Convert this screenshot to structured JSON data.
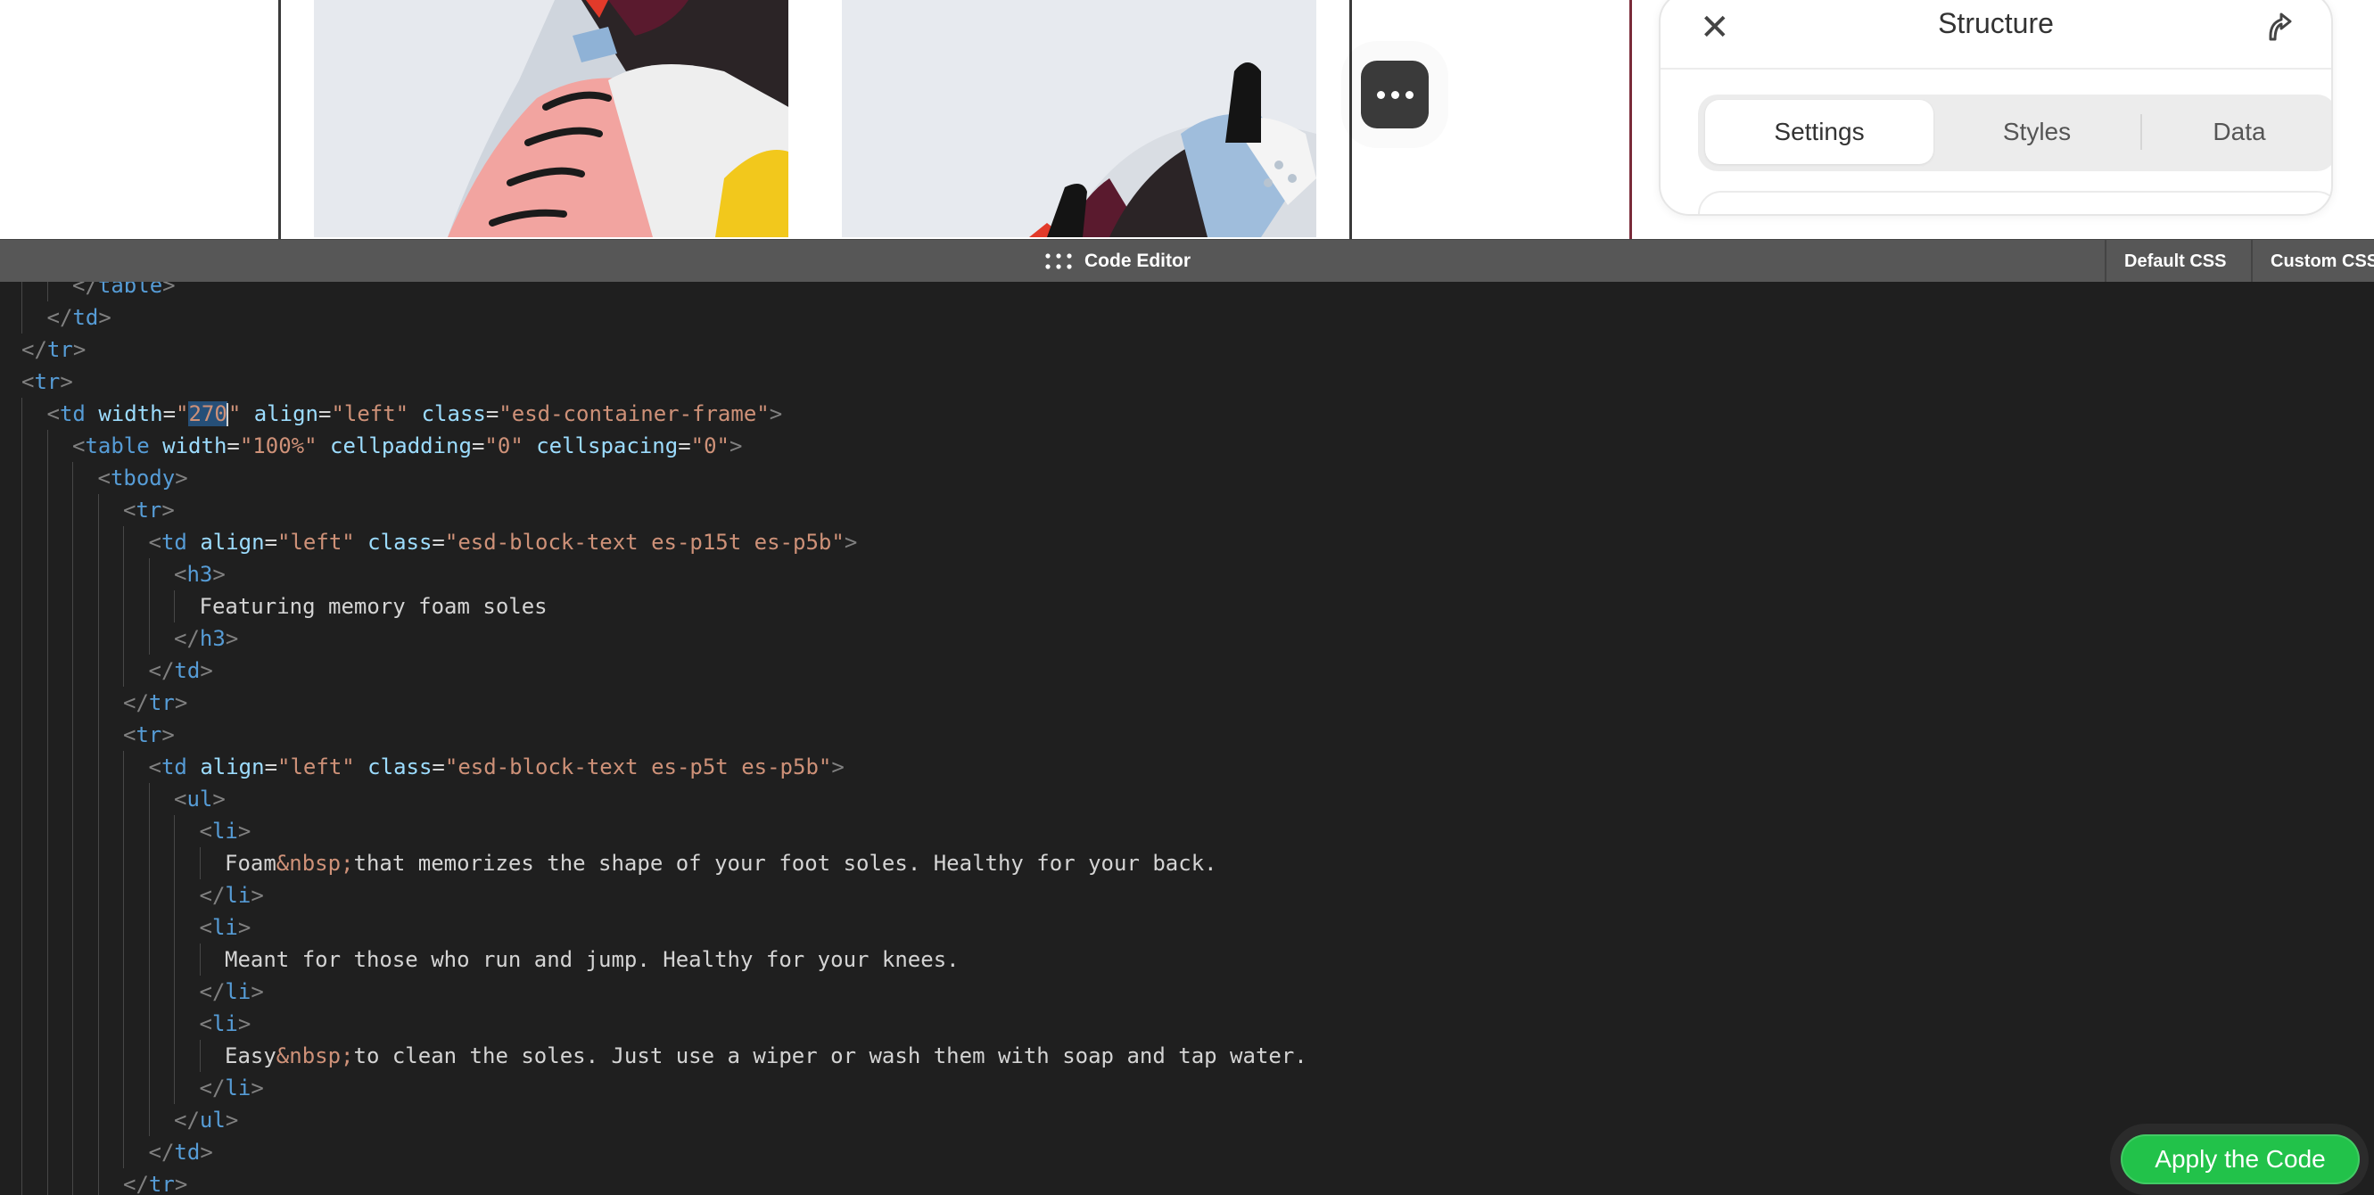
{
  "structure_panel": {
    "title": "Structure",
    "tabs": [
      {
        "label": "Settings",
        "active": true
      },
      {
        "label": "Styles",
        "active": false
      },
      {
        "label": "Data",
        "active": false
      }
    ]
  },
  "editor": {
    "title": "Code Editor",
    "default_css_label": "Default CSS",
    "custom_css_label": "Custom CSS",
    "apply_label": "Apply the Code",
    "selected_text": "270",
    "code_lines": [
      {
        "indent": 2,
        "tokens": [
          [
            "p",
            "</"
          ],
          [
            "t",
            "table"
          ],
          [
            "p",
            ">"
          ]
        ]
      },
      {
        "indent": 1,
        "tokens": [
          [
            "p",
            "</"
          ],
          [
            "t",
            "td"
          ],
          [
            "p",
            ">"
          ]
        ]
      },
      {
        "indent": 0,
        "tokens": [
          [
            "p",
            "</"
          ],
          [
            "t",
            "tr"
          ],
          [
            "p",
            ">"
          ]
        ]
      },
      {
        "indent": 0,
        "tokens": [
          [
            "p",
            "<"
          ],
          [
            "t",
            "tr"
          ],
          [
            "p",
            ">"
          ]
        ]
      },
      {
        "indent": 1,
        "tokens": [
          [
            "p",
            "<"
          ],
          [
            "t",
            "td"
          ],
          [
            "x",
            " "
          ],
          [
            "a",
            "width"
          ],
          [
            "x",
            "="
          ],
          [
            "v",
            "\""
          ],
          [
            "sel",
            "270"
          ],
          [
            "cursor",
            ""
          ],
          [
            "v",
            "\""
          ],
          [
            "x",
            " "
          ],
          [
            "a",
            "align"
          ],
          [
            "x",
            "="
          ],
          [
            "v",
            "\"left\""
          ],
          [
            "x",
            " "
          ],
          [
            "a",
            "class"
          ],
          [
            "x",
            "="
          ],
          [
            "v",
            "\"esd-container-frame\""
          ],
          [
            "p",
            ">"
          ]
        ]
      },
      {
        "indent": 2,
        "tokens": [
          [
            "p",
            "<"
          ],
          [
            "t",
            "table"
          ],
          [
            "x",
            " "
          ],
          [
            "a",
            "width"
          ],
          [
            "x",
            "="
          ],
          [
            "v",
            "\"100%\""
          ],
          [
            "x",
            " "
          ],
          [
            "a",
            "cellpadding"
          ],
          [
            "x",
            "="
          ],
          [
            "v",
            "\"0\""
          ],
          [
            "x",
            " "
          ],
          [
            "a",
            "cellspacing"
          ],
          [
            "x",
            "="
          ],
          [
            "v",
            "\"0\""
          ],
          [
            "p",
            ">"
          ]
        ]
      },
      {
        "indent": 3,
        "tokens": [
          [
            "p",
            "<"
          ],
          [
            "t",
            "tbody"
          ],
          [
            "p",
            ">"
          ]
        ]
      },
      {
        "indent": 4,
        "tokens": [
          [
            "p",
            "<"
          ],
          [
            "t",
            "tr"
          ],
          [
            "p",
            ">"
          ]
        ]
      },
      {
        "indent": 5,
        "tokens": [
          [
            "p",
            "<"
          ],
          [
            "t",
            "td"
          ],
          [
            "x",
            " "
          ],
          [
            "a",
            "align"
          ],
          [
            "x",
            "="
          ],
          [
            "v",
            "\"left\""
          ],
          [
            "x",
            " "
          ],
          [
            "a",
            "class"
          ],
          [
            "x",
            "="
          ],
          [
            "v",
            "\"esd-block-text es-p15t es-p5b\""
          ],
          [
            "p",
            ">"
          ]
        ]
      },
      {
        "indent": 6,
        "tokens": [
          [
            "p",
            "<"
          ],
          [
            "t",
            "h3"
          ],
          [
            "p",
            ">"
          ]
        ]
      },
      {
        "indent": 7,
        "tokens": [
          [
            "x",
            "Featuring memory foam soles"
          ]
        ]
      },
      {
        "indent": 6,
        "tokens": [
          [
            "p",
            "</"
          ],
          [
            "t",
            "h3"
          ],
          [
            "p",
            ">"
          ]
        ]
      },
      {
        "indent": 5,
        "tokens": [
          [
            "p",
            "</"
          ],
          [
            "t",
            "td"
          ],
          [
            "p",
            ">"
          ]
        ]
      },
      {
        "indent": 4,
        "tokens": [
          [
            "p",
            "</"
          ],
          [
            "t",
            "tr"
          ],
          [
            "p",
            ">"
          ]
        ]
      },
      {
        "indent": 4,
        "tokens": [
          [
            "p",
            "<"
          ],
          [
            "t",
            "tr"
          ],
          [
            "p",
            ">"
          ]
        ]
      },
      {
        "indent": 5,
        "tokens": [
          [
            "p",
            "<"
          ],
          [
            "t",
            "td"
          ],
          [
            "x",
            " "
          ],
          [
            "a",
            "align"
          ],
          [
            "x",
            "="
          ],
          [
            "v",
            "\"left\""
          ],
          [
            "x",
            " "
          ],
          [
            "a",
            "class"
          ],
          [
            "x",
            "="
          ],
          [
            "v",
            "\"esd-block-text es-p5t es-p5b\""
          ],
          [
            "p",
            ">"
          ]
        ]
      },
      {
        "indent": 6,
        "tokens": [
          [
            "p",
            "<"
          ],
          [
            "t",
            "ul"
          ],
          [
            "p",
            ">"
          ]
        ]
      },
      {
        "indent": 7,
        "tokens": [
          [
            "p",
            "<"
          ],
          [
            "t",
            "li"
          ],
          [
            "p",
            ">"
          ]
        ]
      },
      {
        "indent": 8,
        "tokens": [
          [
            "x",
            "Foam"
          ],
          [
            "v",
            "&nbsp;"
          ],
          [
            "x",
            "that memorizes the shape of your foot soles. Healthy for your back."
          ]
        ]
      },
      {
        "indent": 7,
        "tokens": [
          [
            "p",
            "</"
          ],
          [
            "t",
            "li"
          ],
          [
            "p",
            ">"
          ]
        ]
      },
      {
        "indent": 7,
        "tokens": [
          [
            "p",
            "<"
          ],
          [
            "t",
            "li"
          ],
          [
            "p",
            ">"
          ]
        ]
      },
      {
        "indent": 8,
        "tokens": [
          [
            "x",
            "Meant for those who run and jump. Healthy for your knees."
          ]
        ]
      },
      {
        "indent": 7,
        "tokens": [
          [
            "p",
            "</"
          ],
          [
            "t",
            "li"
          ],
          [
            "p",
            ">"
          ]
        ]
      },
      {
        "indent": 7,
        "tokens": [
          [
            "p",
            "<"
          ],
          [
            "t",
            "li"
          ],
          [
            "p",
            ">"
          ]
        ]
      },
      {
        "indent": 8,
        "tokens": [
          [
            "x",
            "Easy"
          ],
          [
            "v",
            "&nbsp;"
          ],
          [
            "x",
            "to clean the soles. Just use a wiper or wash them with soap and tap water."
          ]
        ]
      },
      {
        "indent": 7,
        "tokens": [
          [
            "p",
            "</"
          ],
          [
            "t",
            "li"
          ],
          [
            "p",
            ">"
          ]
        ]
      },
      {
        "indent": 6,
        "tokens": [
          [
            "p",
            "</"
          ],
          [
            "t",
            "ul"
          ],
          [
            "p",
            ">"
          ]
        ]
      },
      {
        "indent": 5,
        "tokens": [
          [
            "p",
            "</"
          ],
          [
            "t",
            "td"
          ],
          [
            "p",
            ">"
          ]
        ]
      },
      {
        "indent": 4,
        "tokens": [
          [
            "p",
            "</"
          ],
          [
            "t",
            "tr"
          ],
          [
            "p",
            ">"
          ]
        ]
      }
    ]
  },
  "colors": {
    "editor_bg": "#1f1f1f",
    "tag": "#569cd6",
    "attribute": "#9cdcfe",
    "string": "#ce9178",
    "apply_button": "#22c24a"
  }
}
